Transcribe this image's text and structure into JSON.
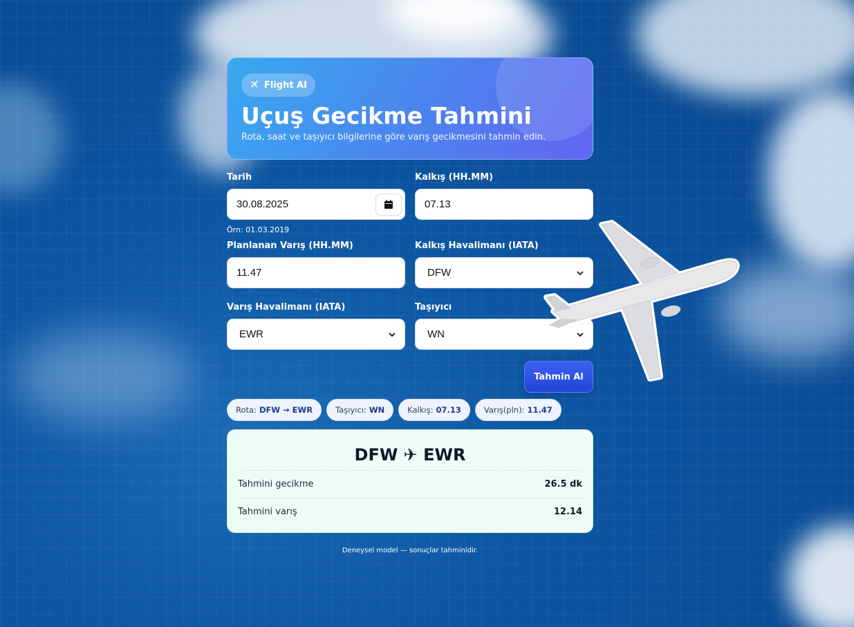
{
  "header": {
    "badge_icon": "airplane-icon",
    "badge_label": "Flight AI",
    "title": "Uçuş Gecikme Tahmini",
    "subtitle": "Rota, saat ve taşıyıcı bilgilerine göre varış gecikmesini tahmin edin."
  },
  "form": {
    "date": {
      "label": "Tarih",
      "value": "30.08.2025",
      "hint": "Örn: 01.03.2019"
    },
    "departure_time": {
      "label": "Kalkış (HH.MM)",
      "value": "07.13"
    },
    "planned_arrival": {
      "label": "Planlanan Varış (HH.MM)",
      "value": "11.47"
    },
    "origin_airport": {
      "label": "Kalkış Havalimanı (IATA)",
      "value": "DFW"
    },
    "dest_airport": {
      "label": "Varış Havalimanı (IATA)",
      "value": "EWR"
    },
    "carrier": {
      "label": "Taşıyıcı",
      "value": "WN"
    },
    "submit_label": "Tahmin Al"
  },
  "chips": {
    "route_label": "Rota:",
    "route_value": "DFW → EWR",
    "carrier_label": "Taşıyıcı:",
    "carrier_value": "WN",
    "dep_label": "Kalkış:",
    "dep_value": "07.13",
    "arr_label": "Varış(pln):",
    "arr_value": "11.47"
  },
  "result": {
    "route": "DFW ✈ EWR",
    "delay_label": "Tahmini gecikme",
    "delay_value": "26.5 dk",
    "arrival_label": "Tahmini varış",
    "arrival_value": "12.14"
  },
  "footer": "Deneysel model — sonuçlar tahminidir.",
  "colors": {
    "accent": "#2146d6",
    "hero_start": "#38aaf0",
    "hero_end": "#6366f1",
    "result_bg": "#edfdf6"
  }
}
